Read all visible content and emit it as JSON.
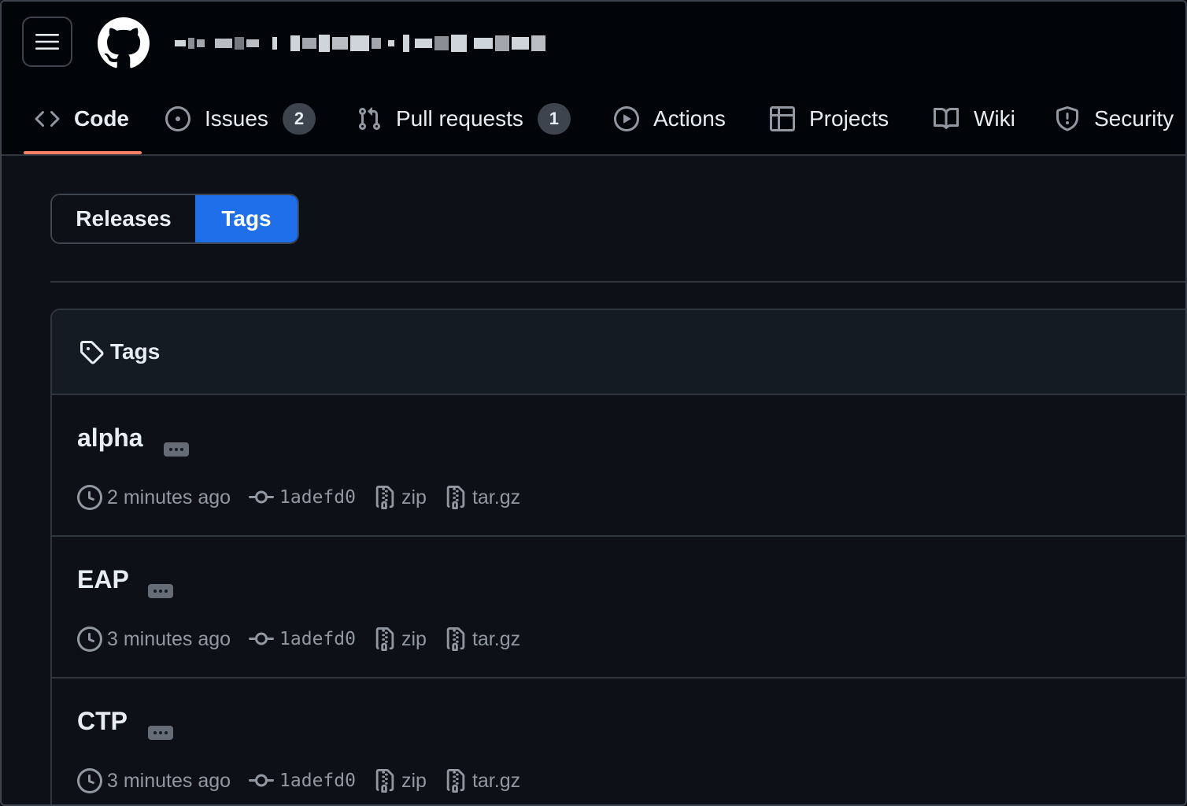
{
  "header": {
    "menu_icon": "hamburger-icon",
    "logo_icon": "github-mark-icon",
    "repo_name_redacted": true
  },
  "tabs": [
    {
      "label": "Code",
      "icon": "code-icon",
      "active": true
    },
    {
      "label": "Issues",
      "icon": "issue-opened-icon",
      "count": "2"
    },
    {
      "label": "Pull requests",
      "icon": "git-pull-request-icon",
      "count": "1"
    },
    {
      "label": "Actions",
      "icon": "play-icon"
    },
    {
      "label": "Projects",
      "icon": "table-icon"
    },
    {
      "label": "Wiki",
      "icon": "book-icon"
    },
    {
      "label": "Security",
      "icon": "shield-icon"
    }
  ],
  "segmented": {
    "releases_label": "Releases",
    "tags_label": "Tags",
    "selected": "Tags"
  },
  "tags_box": {
    "title": "Tags",
    "title_icon": "tag-icon",
    "items": [
      {
        "name": "alpha",
        "time": "2 minutes ago",
        "commit": "1adefd0",
        "zip": "zip",
        "targz": "tar.gz"
      },
      {
        "name": "EAP",
        "time": "3 minutes ago",
        "commit": "1adefd0",
        "zip": "zip",
        "targz": "tar.gz"
      },
      {
        "name": "CTP",
        "time": "3 minutes ago",
        "commit": "1adefd0",
        "zip": "zip",
        "targz": "tar.gz"
      }
    ]
  },
  "colors": {
    "background": "#0d1117",
    "header_bg": "#010409",
    "accent_blue": "#1f6feb",
    "underline": "#f78166",
    "muted_text": "#9198a1"
  }
}
